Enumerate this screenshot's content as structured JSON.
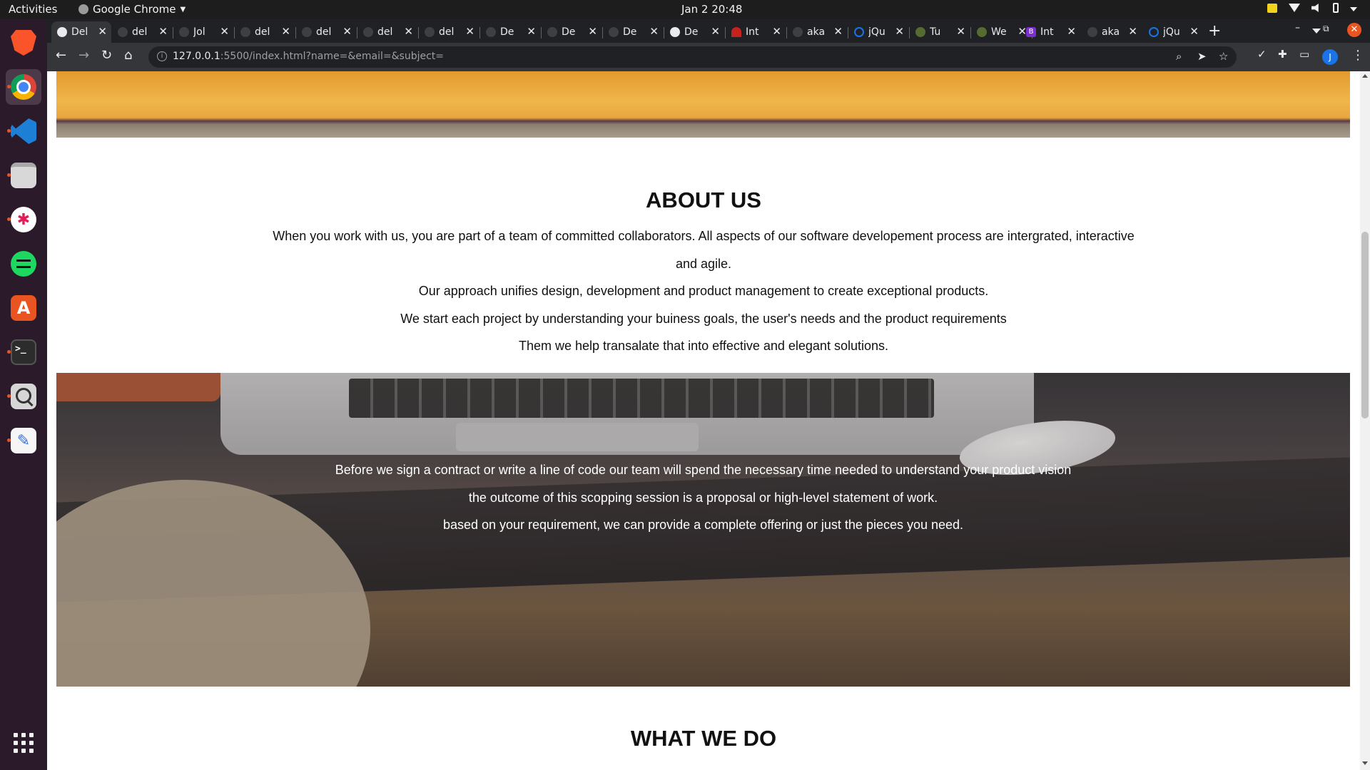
{
  "topbar": {
    "activities": "Activities",
    "app_name": "Google Chrome",
    "clock": "Jan 2  20:48"
  },
  "dock": {
    "items": [
      {
        "name": "Brave",
        "icon": "brave-icon"
      },
      {
        "name": "Google Chrome",
        "icon": "chrome-icon"
      },
      {
        "name": "Visual Studio Code",
        "icon": "vscode-icon"
      },
      {
        "name": "Files",
        "icon": "files-icon"
      },
      {
        "name": "Slack",
        "icon": "slack-icon"
      },
      {
        "name": "Spotify",
        "icon": "spotify-icon"
      },
      {
        "name": "Ubuntu Software",
        "icon": "store-icon"
      },
      {
        "name": "Terminal",
        "icon": "terminal-icon"
      },
      {
        "name": "Magnifier",
        "icon": "magnifier-icon"
      },
      {
        "name": "Text Editor",
        "icon": "text-editor-icon"
      },
      {
        "name": "Show Applications",
        "icon": "app-grid-icon"
      }
    ],
    "accent": "#e95420"
  },
  "tabs": [
    {
      "title": "Del",
      "active": true
    },
    {
      "title": "del"
    },
    {
      "title": "Jol"
    },
    {
      "title": "del"
    },
    {
      "title": "del"
    },
    {
      "title": "del"
    },
    {
      "title": "del"
    },
    {
      "title": "De"
    },
    {
      "title": "De"
    },
    {
      "title": "De"
    },
    {
      "title": "De"
    },
    {
      "title": "Int"
    },
    {
      "title": "aka"
    },
    {
      "title": "jQu"
    },
    {
      "title": "Tu"
    },
    {
      "title": "We"
    },
    {
      "title": "Int"
    },
    {
      "title": "aka"
    },
    {
      "title": "jQu"
    }
  ],
  "address_bar": {
    "host": "127.0.0.1",
    "rest": ":5500/index.html?name=&email=&subject="
  },
  "profile_initial": "J",
  "page": {
    "about_title": "ABOUT US",
    "about_paragraphs": [
      "When you work with us, you are part of a team of committed collaborators. All aspects of our software developement process are intergrated, interactive and agile.",
      "Our approach unifies design, development and product management to create exceptional products.",
      "We start each project by understanding your buiness goals, the user's needs and the product requirements",
      "Them we help transalate that into effective and elegant solutions."
    ],
    "hero_paragraphs": [
      "Before we sign a contract or write a line of code our team will spend the necessary time needed to understand your product vision",
      "the outcome of this scopping session is a proposal or high-level statement of work.",
      "based on your requirement, we can provide a complete offering or just the pieces you need."
    ],
    "what_title": "WHAT WE DO"
  }
}
